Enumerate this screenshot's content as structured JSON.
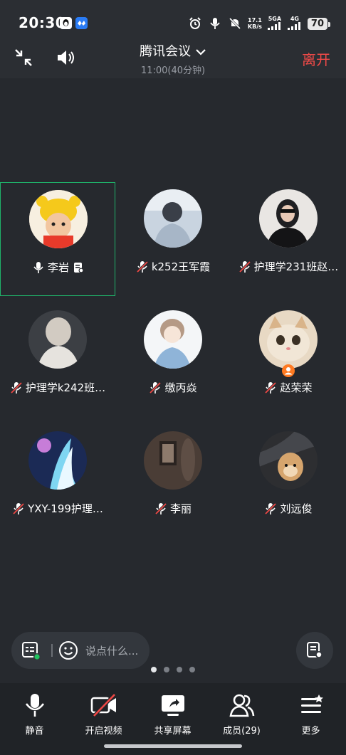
{
  "status_bar": {
    "time": "20:30",
    "net_speed_top": "17.1",
    "net_speed_unit": "KB/s",
    "sim1": "5GA",
    "sim2": "4G",
    "battery": "70"
  },
  "header": {
    "title": "腾讯会议",
    "subtitle": "11:00(40分钟)",
    "leave_label": "离开"
  },
  "participants": [
    {
      "name": "李岩",
      "muted": false,
      "active": true
    },
    {
      "name": "k252王军霞",
      "muted": true
    },
    {
      "name": "护理学231班赵…",
      "muted": true
    },
    {
      "name": "护理学k242班…",
      "muted": true
    },
    {
      "name": "缴丙焱",
      "muted": true
    },
    {
      "name": "赵荣荣",
      "muted": true,
      "host": true
    },
    {
      "name": "YXY-199护理…",
      "muted": true
    },
    {
      "name": "李丽",
      "muted": true
    },
    {
      "name": "刘远俊",
      "muted": true
    }
  ],
  "chat": {
    "placeholder": "说点什么..."
  },
  "pager": {
    "pages": 4,
    "current": 1
  },
  "toolbar": {
    "mute_label": "静音",
    "video_label": "开启视频",
    "share_label": "共享屏幕",
    "members_label": "成员(29)",
    "more_label": "更多"
  },
  "colors": {
    "accent_leave": "#f04a48",
    "active_border": "#1fb36a",
    "host_badge": "#ff7a21"
  }
}
